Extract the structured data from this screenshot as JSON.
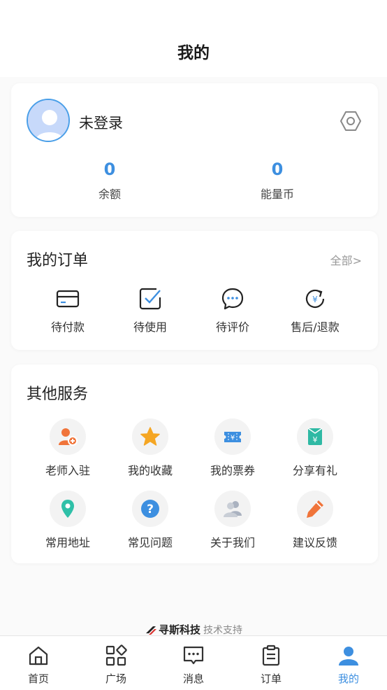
{
  "header": {
    "title": "我的"
  },
  "profile": {
    "name": "未登录",
    "balance": {
      "value": "0",
      "label": "余额"
    },
    "coins": {
      "value": "0",
      "label": "能量币"
    }
  },
  "orders": {
    "title": "我的订单",
    "all_label": "全部>",
    "items": [
      {
        "label": "待付款",
        "icon": "card-icon"
      },
      {
        "label": "待使用",
        "icon": "checkbox-icon"
      },
      {
        "label": "待评价",
        "icon": "comment-icon"
      },
      {
        "label": "售后/退款",
        "icon": "refund-icon"
      }
    ]
  },
  "services": {
    "title": "其他服务",
    "items": [
      {
        "label": "老师入驻",
        "icon": "teacher-join-icon"
      },
      {
        "label": "我的收藏",
        "icon": "star-icon"
      },
      {
        "label": "我的票券",
        "icon": "ticket-icon"
      },
      {
        "label": "分享有礼",
        "icon": "gift-icon"
      },
      {
        "label": "常用地址",
        "icon": "location-icon"
      },
      {
        "label": "常见问题",
        "icon": "question-icon"
      },
      {
        "label": "关于我们",
        "icon": "about-icon"
      },
      {
        "label": "建议反馈",
        "icon": "feedback-icon"
      }
    ]
  },
  "credit": {
    "brand": "寻斯科技",
    "text": "技术支持"
  },
  "tabbar": {
    "items": [
      {
        "label": "首页",
        "icon": "home-icon"
      },
      {
        "label": "广场",
        "icon": "grid-icon"
      },
      {
        "label": "消息",
        "icon": "message-icon"
      },
      {
        "label": "订单",
        "icon": "clipboard-icon"
      },
      {
        "label": "我的",
        "icon": "user-icon",
        "active": true
      }
    ]
  },
  "colors": {
    "accent": "#3d8fe0",
    "orange": "#f0743a"
  }
}
